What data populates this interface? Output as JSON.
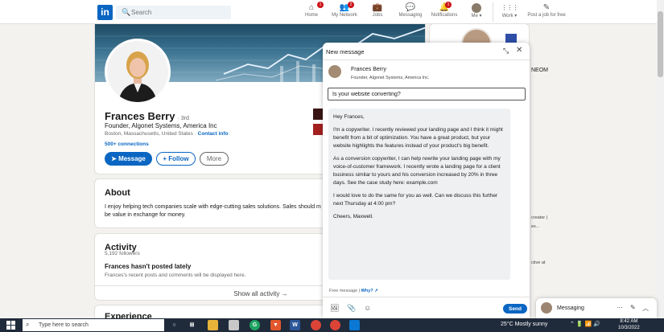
{
  "nav": {
    "logo": "in",
    "search_placeholder": "Search",
    "items": [
      {
        "label": "Home",
        "icon": "home-icon",
        "glyph": "⌂",
        "badge": "1"
      },
      {
        "label": "My Network",
        "icon": "network-icon",
        "glyph": "👥",
        "badge": "2"
      },
      {
        "label": "Jobs",
        "icon": "jobs-icon",
        "glyph": "💼",
        "badge": ""
      },
      {
        "label": "Messaging",
        "icon": "messaging-icon",
        "glyph": "💬",
        "badge": ""
      },
      {
        "label": "Notifications",
        "icon": "bell-icon",
        "glyph": "🔔",
        "badge": "1"
      },
      {
        "label": "Me ▾",
        "icon": "me-avatar",
        "glyph": "",
        "badge": ""
      },
      {
        "label": "Work ▾",
        "icon": "grid-icon",
        "glyph": "⋮⋮⋮",
        "badge": ""
      },
      {
        "label": "Post a job for free",
        "icon": "post-job-icon",
        "glyph": "✎",
        "badge": ""
      }
    ]
  },
  "profile": {
    "name": "Frances Berry",
    "degree": "· 3rd",
    "headline": "Founder, Algonet Systems, America Inc",
    "location": "Boston, Massachusetts, United States ·",
    "contact_info": "Contact info",
    "connections": "500+ connections",
    "message_label": "Message",
    "follow_label": "+ Follow",
    "more_label": "More"
  },
  "about": {
    "title": "About",
    "text": "I enjoy helping tech companies scale with edge-cutting sales solutions. Sales should m be value in exchange for money."
  },
  "activity": {
    "title": "Activity",
    "followers": "5,192 followers",
    "heading": "Frances hasn't posted lately",
    "sub": "Frances's recent posts and comments will be displayed here.",
    "show_all": "Show all activity →"
  },
  "experience_title": "Experience",
  "right_peek": {
    "neom": "NEOM",
    "t1": "creator |",
    "t2": "es...",
    "t3": "ctive at"
  },
  "new_message": {
    "title": "New message",
    "recipient_name": "Frances Berry",
    "recipient_headline": "Founder, Algonet Systems, America Inc.",
    "subject": "Is your website converting?",
    "body": [
      "Hey Frances,",
      "I'm a copywriter. I recently reviewed your landing page and I think it might benefit from a bit of optimization. You have a great product, but your website highlights the features instead of your product's big benefit.",
      "As a conversion copywriter, I can help rewrite your landing page with my voice-of-customer framework. I recently wrote a landing page for a client business similar to yours and his conversion increased by 20% in three days. See the case study here: example.com",
      "I would love to do the same for you as well. Can we discuss this further next Thursday at 4:00 pm?",
      "Cheers, Maxwell."
    ],
    "free_message": "Free message |",
    "why": "Why?",
    "send_label": "Send"
  },
  "messaging_bar": {
    "label": "Messaging"
  },
  "taskbar": {
    "search_placeholder": "Type here to search",
    "weather": "25°C  Mostly sunny",
    "time": "8:42 AM",
    "date": "10/3/2022"
  },
  "colors": {
    "brand": "#0a66c2",
    "badge": "#cc1016",
    "taskbar": "#1f2a3a"
  }
}
